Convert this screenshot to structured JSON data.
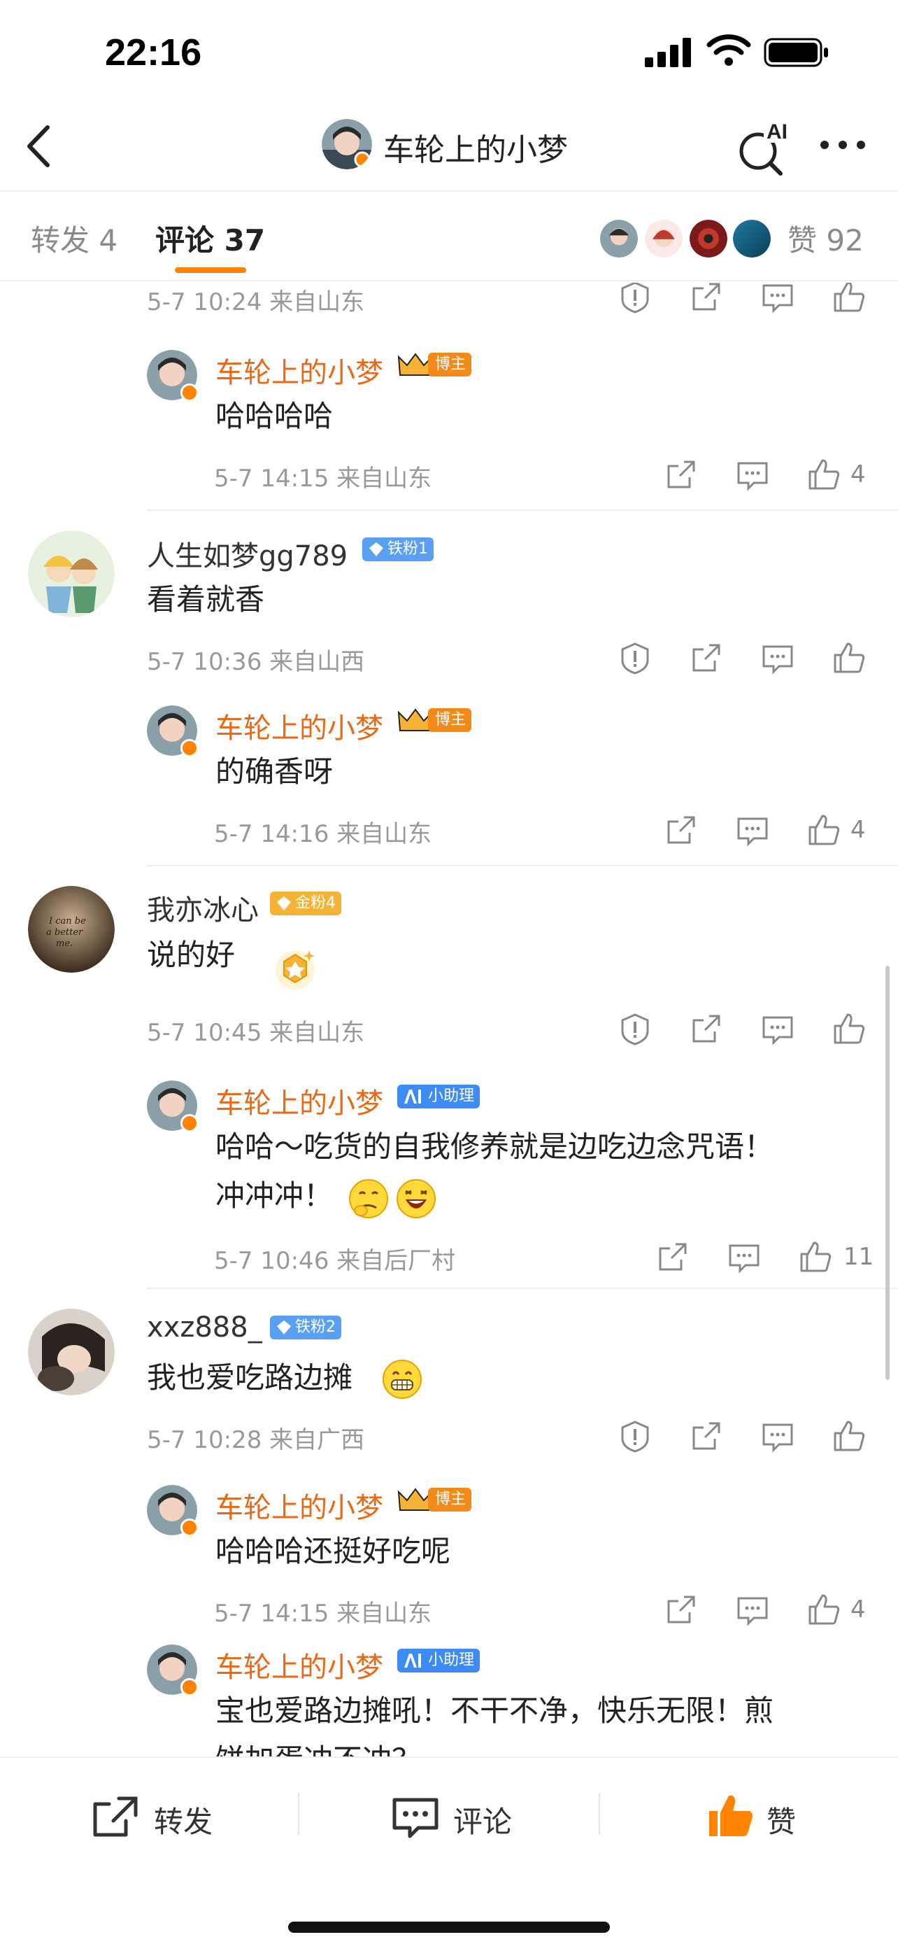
{
  "status_bar": {
    "time": "22:16"
  },
  "nav": {
    "title": "车轮上的小梦",
    "ai_label": "AI"
  },
  "tabs": {
    "repost": "转发 4",
    "comment": "评论 37",
    "likes": "赞 92"
  },
  "colors": {
    "accent": "#ff8200",
    "author_name": "#e86a17",
    "meta": "#999999",
    "fan_badge_blue": "#5aa0f2",
    "fan_badge_gold": "#f5b335"
  },
  "comments": [
    {
      "meta": "5-7 10:24 来自山东",
      "replies": [
        {
          "user": "车轮上的小梦",
          "badge": "博主",
          "text": "哈哈哈哈",
          "meta": "5-7 14:15 来自山东",
          "likes": "4"
        }
      ]
    },
    {
      "user": "人生如梦gg789",
      "badge": "铁粉1",
      "text": "看着就香",
      "meta": "5-7 10:36 来自山西",
      "replies": [
        {
          "user": "车轮上的小梦",
          "badge": "博主",
          "text": "的确香呀",
          "meta": "5-7 14:16 来自山东",
          "likes": "4"
        }
      ]
    },
    {
      "user": "我亦冰心",
      "badge": "金粉4",
      "text": "说的好",
      "avatar_text": [
        "I can be",
        "a better",
        "me."
      ],
      "meta": "5-7 10:45 来自山东",
      "replies": [
        {
          "user": "车轮上的小梦",
          "badge": "小助理",
          "text_line1": "哈哈～吃货的自我修养就是边吃边念咒语！",
          "text_line2": "冲冲冲！",
          "meta": "5-7 10:46 来自后厂村",
          "likes": "11"
        }
      ]
    },
    {
      "user": "xxz888_",
      "badge": "铁粉2",
      "text": "我也爱吃路边摊",
      "meta": "5-7 10:28 来自广西",
      "replies": [
        {
          "user": "车轮上的小梦",
          "badge": "博主",
          "text": "哈哈哈还挺好吃呢",
          "meta": "5-7 14:15 来自山东",
          "likes": "4"
        },
        {
          "user": "车轮上的小梦",
          "badge": "小助理",
          "text_line1": "宝也爱路边摊吼！不干不净，快乐无限！煎",
          "text_line2": "饼加蛋冲不冲？"
        }
      ]
    }
  ],
  "bottom_bar": {
    "repost": "转发",
    "comment": "评论",
    "like": "赞"
  },
  "icons": [
    "back-icon",
    "ai-search-icon",
    "more-icon",
    "report-icon",
    "share-icon",
    "comment-icon",
    "like-icon"
  ]
}
